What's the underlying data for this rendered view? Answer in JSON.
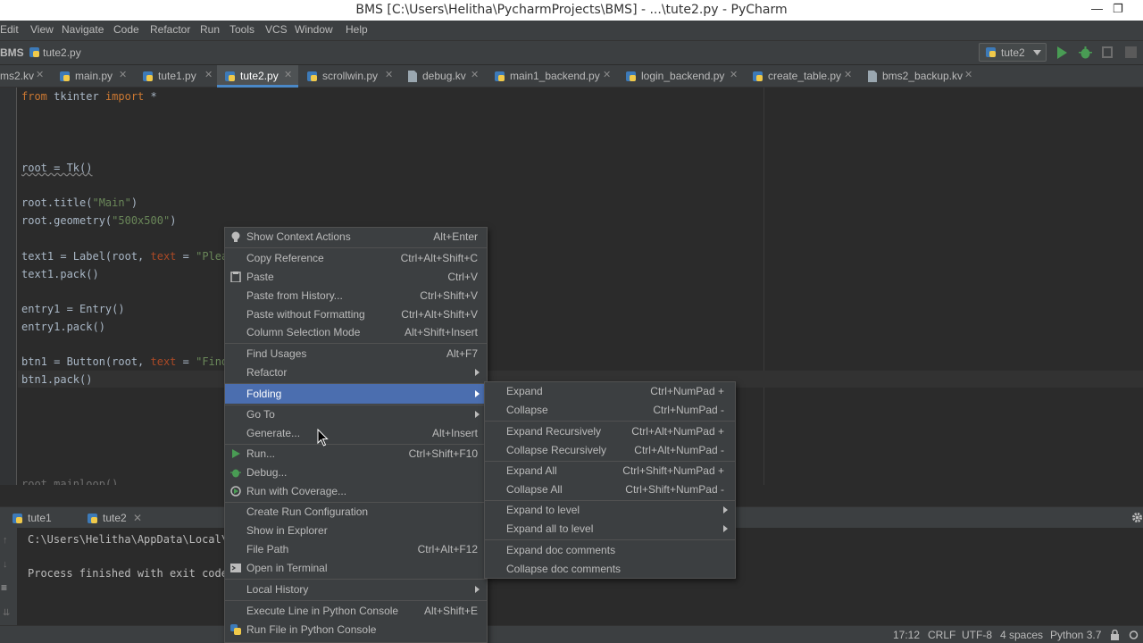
{
  "window": {
    "title": "BMS [C:\\Users\\Helitha\\PycharmProjects\\BMS] - ...\\tute2.py - PyCharm",
    "minimize": "—",
    "restore": "❐"
  },
  "menubar": [
    "Edit",
    "View",
    "Navigate",
    "Code",
    "Refactor",
    "Run",
    "Tools",
    "VCS",
    "Window",
    "Help"
  ],
  "breadcrumb": {
    "project": "BMS",
    "file": "tute2.py"
  },
  "run_config": {
    "label": "tute2"
  },
  "tabs": [
    {
      "label": "ms2.kv"
    },
    {
      "label": "main.py"
    },
    {
      "label": "tute1.py"
    },
    {
      "label": "tute2.py"
    },
    {
      "label": "scrollwin.py"
    },
    {
      "label": "debug.kv"
    },
    {
      "label": "main1_backend.py"
    },
    {
      "label": "login_backend.py"
    },
    {
      "label": "create_table.py"
    },
    {
      "label": "bms2_backup.kv"
    }
  ],
  "code": {
    "l1_kw": "from",
    "l1_mid": " tkinter ",
    "l1_kw2": "import",
    "l1_end": " *",
    "l2": "root = Tk()",
    "l3_a": "root.title(",
    "l3_s": "\"Main\"",
    "l3_b": ")",
    "l4_a": "root.geometry(",
    "l4_s": "\"500x500\"",
    "l4_b": ")",
    "l5_a": "text1 = Label(root, ",
    "l5_p": "text",
    "l5_eq": " = ",
    "l5_s": "\"Pleas",
    "l6": "text1.pack()",
    "l7": "entry1 = Entry()",
    "l8": "entry1.pack()",
    "l9_a": "btn1 = Button(root, ",
    "l9_p": "text",
    "l9_eq": " = ",
    "l9_s": "\"Find",
    "l10": "btn1.pack()",
    "l11": "root.mainloop()"
  },
  "run_panel": {
    "tabs": [
      "tute1",
      "tute2"
    ],
    "path_line": "C:\\Users\\Helitha\\AppData\\Local\\P",
    "exit_line": "Process finished with exit code"
  },
  "context_menu": [
    {
      "label": "Show Context Actions",
      "shortcut": "Alt+Enter",
      "icon": "bulb-icon"
    },
    {
      "label": "Copy Reference",
      "shortcut": "Ctrl+Alt+Shift+C"
    },
    {
      "label": "Paste",
      "shortcut": "Ctrl+V",
      "icon": "clipboard-icon"
    },
    {
      "label": "Paste from History...",
      "shortcut": "Ctrl+Shift+V"
    },
    {
      "label": "Paste without Formatting",
      "shortcut": "Ctrl+Alt+Shift+V"
    },
    {
      "label": "Column Selection Mode",
      "shortcut": "Alt+Shift+Insert"
    },
    {
      "label": "Find Usages",
      "shortcut": "Alt+F7"
    },
    {
      "label": "Refactor",
      "submenu": true
    },
    {
      "label": "Folding",
      "submenu": true,
      "selected": true
    },
    {
      "label": "Go To",
      "submenu": true
    },
    {
      "label": "Generate...",
      "shortcut": "Alt+Insert"
    },
    {
      "label": "Run...",
      "shortcut": "Ctrl+Shift+F10",
      "icon": "run-icon"
    },
    {
      "label": "Debug...",
      "icon": "debug-icon"
    },
    {
      "label": "Run with Coverage...",
      "icon": "coverage-icon"
    },
    {
      "label": "Create Run Configuration"
    },
    {
      "label": "Show in Explorer"
    },
    {
      "label": "File Path",
      "shortcut": "Ctrl+Alt+F12"
    },
    {
      "label": "Open in Terminal",
      "icon": "terminal-icon"
    },
    {
      "label": "Local History",
      "submenu": true
    },
    {
      "label": "Execute Line in Python Console",
      "shortcut": "Alt+Shift+E"
    },
    {
      "label": "Run File in Python Console",
      "icon": "python-icon"
    }
  ],
  "folding_submenu": [
    {
      "label": "Expand",
      "shortcut": "Ctrl+NumPad +"
    },
    {
      "label": "Collapse",
      "shortcut": "Ctrl+NumPad -"
    },
    {
      "label": "Expand Recursively",
      "shortcut": "Ctrl+Alt+NumPad +"
    },
    {
      "label": "Collapse Recursively",
      "shortcut": "Ctrl+Alt+NumPad -"
    },
    {
      "label": "Expand All",
      "shortcut": "Ctrl+Shift+NumPad +"
    },
    {
      "label": "Collapse All",
      "shortcut": "Ctrl+Shift+NumPad -"
    },
    {
      "label": "Expand to level",
      "submenu": true
    },
    {
      "label": "Expand all to level",
      "submenu": true
    },
    {
      "label": "Expand doc comments"
    },
    {
      "label": "Collapse doc comments"
    }
  ],
  "status": {
    "position": "17:12",
    "line_sep": "CRLF",
    "encoding": "UTF-8",
    "indent": "4 spaces",
    "interpreter": "Python 3.7"
  },
  "colors": {
    "accent": "#4b6eaf",
    "editor_bg": "#2b2b2b",
    "panel_bg": "#3c3f41",
    "keyword": "#cc7832",
    "string": "#6a8759",
    "run_green": "#499c54"
  }
}
